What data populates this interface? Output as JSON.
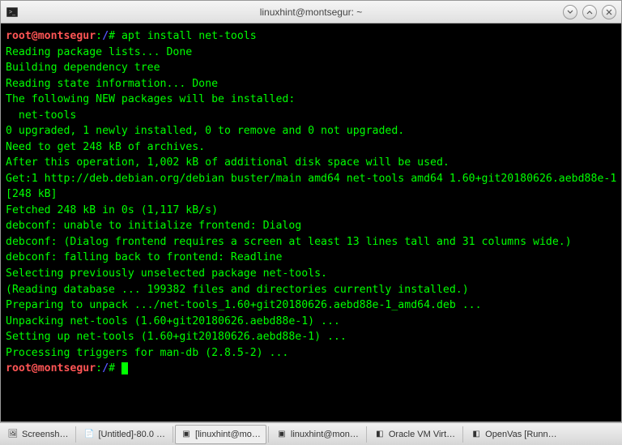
{
  "window": {
    "title": "linuxhint@montsegur: ~"
  },
  "prompt": {
    "user_host": "root@montsegur",
    "path_sep": ":",
    "path": "/",
    "symbol": "#",
    "command": "apt install net-tools"
  },
  "output": {
    "lines": [
      "Reading package lists... Done",
      "Building dependency tree",
      "Reading state information... Done",
      "The following NEW packages will be installed:",
      "  net-tools",
      "0 upgraded, 1 newly installed, 0 to remove and 0 not upgraded.",
      "Need to get 248 kB of archives.",
      "After this operation, 1,002 kB of additional disk space will be used.",
      "Get:1 http://deb.debian.org/debian buster/main amd64 net-tools amd64 1.60+git20180626.aebd88e-1 [248 kB]",
      "Fetched 248 kB in 0s (1,117 kB/s)",
      "debconf: unable to initialize frontend: Dialog",
      "debconf: (Dialog frontend requires a screen at least 13 lines tall and 31 columns wide.)",
      "debconf: falling back to frontend: Readline",
      "Selecting previously unselected package net-tools.",
      "(Reading database ... 199382 files and directories currently installed.)",
      "Preparing to unpack .../net-tools_1.60+git20180626.aebd88e-1_amd64.deb ...",
      "Unpacking net-tools (1.60+git20180626.aebd88e-1) ...",
      "Setting up net-tools (1.60+git20180626.aebd88e-1) ...",
      "Processing triggers for man-db (2.8.5-2) ..."
    ]
  },
  "prompt2": {
    "user_host": "root@montsegur",
    "path_sep": ":",
    "path": "/",
    "symbol": "#"
  },
  "taskbar": {
    "items": [
      {
        "label": "Screensh…",
        "icon": "🖼"
      },
      {
        "label": "[Untitled]-80.0 …",
        "icon": "📄"
      },
      {
        "label": "[linuxhint@mo…",
        "icon": "▣",
        "active": true
      },
      {
        "label": "linuxhint@mon…",
        "icon": "▣"
      },
      {
        "label": "Oracle VM Virt…",
        "icon": "◧"
      },
      {
        "label": "OpenVas [Runn…",
        "icon": "◧"
      }
    ]
  }
}
